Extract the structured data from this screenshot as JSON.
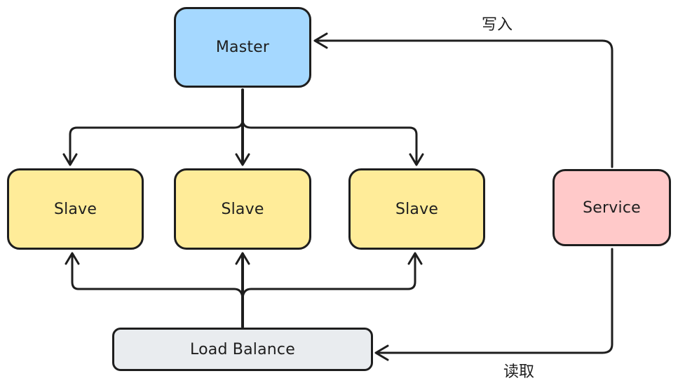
{
  "nodes": {
    "master": {
      "label": "Master",
      "color": "#a5d8ff"
    },
    "slave_1": {
      "label": "Slave",
      "color": "#ffec99"
    },
    "slave_2": {
      "label": "Slave",
      "color": "#ffec99"
    },
    "slave_3": {
      "label": "Slave",
      "color": "#ffec99"
    },
    "service": {
      "label": "Service",
      "color": "#ffc9c9"
    },
    "load_balance": {
      "label": "Load Balance",
      "color": "#e9ecef"
    }
  },
  "edges": {
    "write_label": "写入",
    "read_label": "读取"
  },
  "stroke_color": "#1e1e1e"
}
